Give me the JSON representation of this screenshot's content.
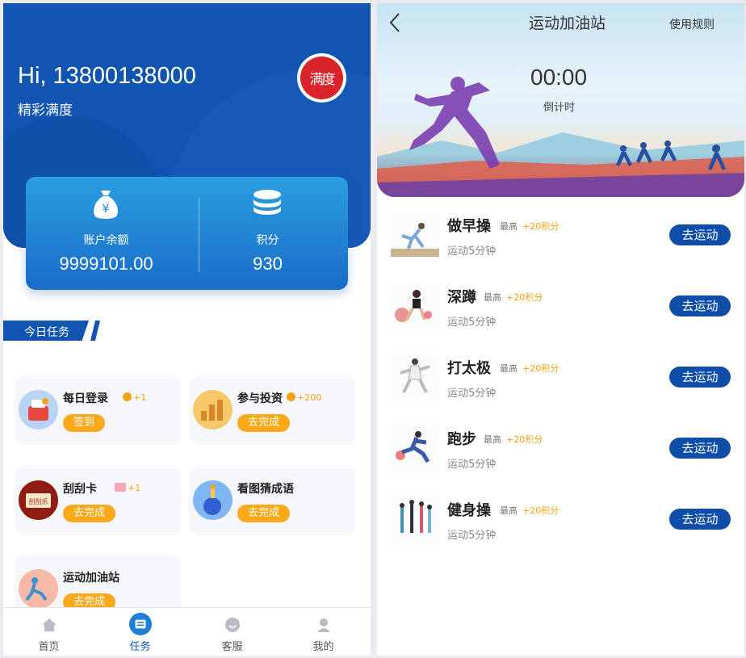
{
  "left": {
    "greeting": "Hi, 13800138000",
    "nickname": "精彩满度",
    "avatar_text": "满度",
    "account": {
      "balance_label": "账户余额",
      "balance_value": "9999101.00",
      "points_label": "积分",
      "points_value": "930"
    },
    "section_title": "今日任务",
    "tasks": [
      {
        "name": "每日登录",
        "reward": "+1",
        "button": "签到"
      },
      {
        "name": "参与投资",
        "reward": "+200",
        "button": "去完成"
      },
      {
        "name": "刮刮卡",
        "reward": "+1",
        "button": "去完成"
      },
      {
        "name": "看图猜成语",
        "reward": "",
        "button": "去完成"
      },
      {
        "name": "运动加油站",
        "reward": "",
        "button": "去完成"
      }
    ],
    "tabbar": [
      {
        "label": "首页",
        "icon": "home-icon"
      },
      {
        "label": "任务",
        "icon": "task-icon"
      },
      {
        "label": "客服",
        "icon": "service-icon"
      },
      {
        "label": "我的",
        "icon": "profile-icon"
      }
    ],
    "colors": {
      "primary": "#1254b1",
      "accent": "#fba81a"
    }
  },
  "right": {
    "title": "运动加油站",
    "rules_link": "使用规则",
    "timer": "00:00",
    "timer_label": "倒计时",
    "exercises": [
      {
        "name": "做早操",
        "max_label": "最高",
        "points": "+20积分",
        "duration": "运动5分钟",
        "button": "去运动"
      },
      {
        "name": "深蹲",
        "max_label": "最高",
        "points": "+20积分",
        "duration": "运动5分钟",
        "button": "去运动"
      },
      {
        "name": "打太极",
        "max_label": "最高",
        "points": "+20积分",
        "duration": "运动5分钟",
        "button": "去运动"
      },
      {
        "name": "跑步",
        "max_label": "最高",
        "points": "+20积分",
        "duration": "运动5分钟",
        "button": "去运动"
      },
      {
        "name": "健身操",
        "max_label": "最高",
        "points": "+20积分",
        "duration": "运动5分钟",
        "button": "去运动"
      }
    ]
  }
}
